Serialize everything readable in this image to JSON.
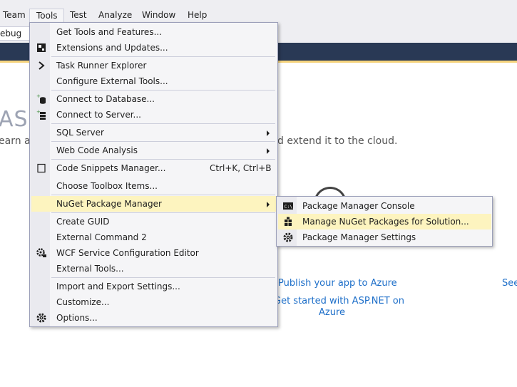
{
  "menubar": {
    "items": [
      {
        "label": "Team"
      },
      {
        "label": "Tools",
        "active": true
      },
      {
        "label": "Test"
      },
      {
        "label": "Analyze"
      },
      {
        "label": "Window"
      },
      {
        "label": "Help"
      }
    ]
  },
  "toolbar": {
    "config_value": "ebug"
  },
  "start_page": {
    "title_fragment": "ASP",
    "subtitle_left": "earn ab",
    "subtitle_right": "d extend it to the cloud.",
    "links": {
      "publish": "Publish your app to Azure",
      "get_started_line1": "Get started with ASP.NET on",
      "get_started_line2": "Azure",
      "see": "See"
    }
  },
  "tools_menu": {
    "items": [
      {
        "label": "Get Tools and Features...",
        "icon": ""
      },
      {
        "label": "Extensions and Updates...",
        "icon": "extensions-icon"
      },
      {
        "label": "Task Runner Explorer",
        "icon": "chevron-right-icon"
      },
      {
        "label": "Configure External Tools...",
        "icon": ""
      },
      {
        "label": "Connect to Database...",
        "icon": "database-icon"
      },
      {
        "label": "Connect to Server...",
        "icon": "server-icon"
      },
      {
        "label": "SQL Server",
        "icon": "",
        "submenu": true
      },
      {
        "label": "Web Code Analysis",
        "icon": "",
        "submenu": true
      },
      {
        "label": "Code Snippets Manager...",
        "icon": "checkbox-icon",
        "shortcut": "Ctrl+K, Ctrl+B"
      },
      {
        "label": "Choose Toolbox Items...",
        "icon": ""
      },
      {
        "label": "NuGet Package Manager",
        "icon": "",
        "submenu": true,
        "highlighted": true
      },
      {
        "label": "Create GUID",
        "icon": ""
      },
      {
        "label": "External Command 2",
        "icon": ""
      },
      {
        "label": "WCF Service Configuration Editor",
        "icon": "wcf-gear-icon"
      },
      {
        "label": "External Tools...",
        "icon": ""
      },
      {
        "label": "Import and Export Settings...",
        "icon": ""
      },
      {
        "label": "Customize...",
        "icon": ""
      },
      {
        "label": "Options...",
        "icon": "gear-icon"
      }
    ]
  },
  "nuget_menu": {
    "items": [
      {
        "label": "Package Manager Console",
        "icon": "console-icon"
      },
      {
        "label": "Manage NuGet Packages for Solution...",
        "icon": "package-icon",
        "highlighted": true
      },
      {
        "label": "Package Manager Settings",
        "icon": "gear-icon"
      }
    ]
  },
  "colors": {
    "menu_bg": "#f5f5f7",
    "highlight": "#fdf4bf",
    "nav_band": "#293955",
    "link": "#1e6fc9"
  }
}
